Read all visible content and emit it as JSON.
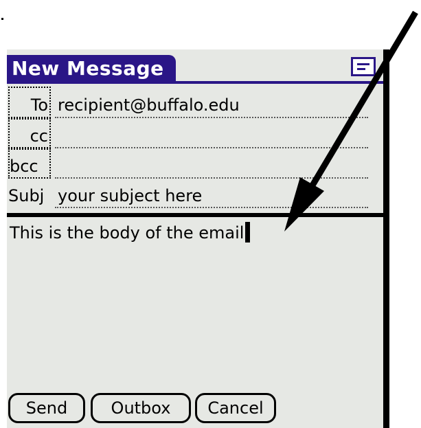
{
  "window": {
    "title": "New Message"
  },
  "header": {
    "menu_icon": "menu-icon"
  },
  "fields": {
    "to": {
      "label": "To",
      "value": "recipient@buffalo.edu"
    },
    "cc": {
      "label": "cc",
      "value": ""
    },
    "bcc": {
      "label": "bcc",
      "value": ""
    },
    "subj": {
      "label": "Subj",
      "value": "your subject here"
    }
  },
  "body": {
    "text": "This is the body of the email"
  },
  "buttons": {
    "send": "Send",
    "outbox": "Outbox",
    "cancel": "Cancel"
  },
  "annotation": {
    "icon": "arrow-pointer-icon",
    "color": "#000000"
  },
  "colors": {
    "accent": "#2a1687",
    "background": "#e6e8e4"
  }
}
